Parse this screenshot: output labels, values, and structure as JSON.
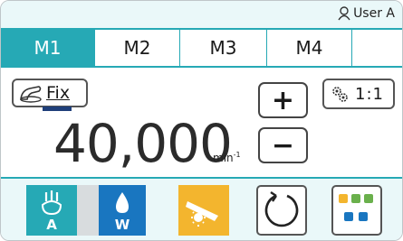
{
  "header": {
    "user_label": "User A",
    "user_icon": "user-icon"
  },
  "tabs": [
    {
      "label": "M1",
      "active": true
    },
    {
      "label": "M2",
      "active": false
    },
    {
      "label": "M3",
      "active": false
    },
    {
      "label": "M4",
      "active": false
    }
  ],
  "controls": {
    "fix_label": "Fix",
    "fix_icon": "foot-control-icon",
    "speed_value": "40,000",
    "speed_unit": "min",
    "speed_unit_exponent": "-1",
    "increase_label": "+",
    "decrease_label": "−",
    "ratio_label": "1:1",
    "ratio_icon": "gear-icon"
  },
  "bottom": {
    "air_label": "A",
    "water_label": "W",
    "light_icon": "light-icon",
    "rotation_icon": "rotation-icon",
    "settings_icon": "multi-settings-icon"
  },
  "colors": {
    "accent": "#26a9b5",
    "water": "#1976c0",
    "light": "#f3b52e",
    "header_bg": "#eaf8f9",
    "fix_bar": "#1f3f7a"
  }
}
